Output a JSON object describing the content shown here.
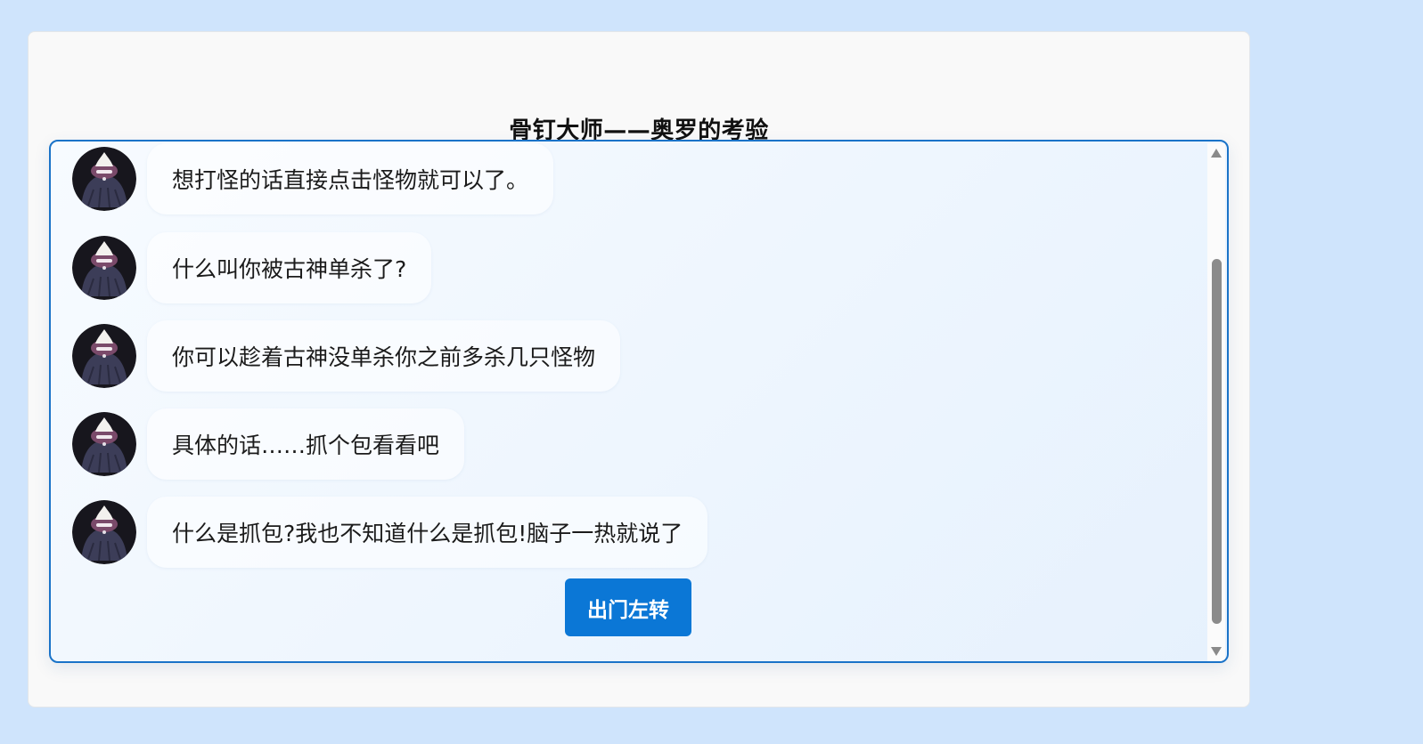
{
  "page": {
    "title": "骨钉大师——奥罗的考验"
  },
  "messages": [
    {
      "avatar": "npc-portrait-icon",
      "text": "想打怪的话直接点击怪物就可以了。"
    },
    {
      "avatar": "npc-portrait-icon",
      "text": "什么叫你被古神单杀了?"
    },
    {
      "avatar": "npc-portrait-icon",
      "text": "你可以趁着古神没单杀你之前多杀几只怪物"
    },
    {
      "avatar": "npc-portrait-icon",
      "text": "具体的话……抓个包看看吧"
    },
    {
      "avatar": "npc-portrait-icon",
      "text": "什么是抓包?我也不知道什么是抓包!脑子一热就说了"
    }
  ],
  "actions": {
    "primary_label": "出门左转"
  },
  "colors": {
    "background": "#cfe4fc",
    "accent": "#0b77d6",
    "border": "#1a73c8"
  }
}
